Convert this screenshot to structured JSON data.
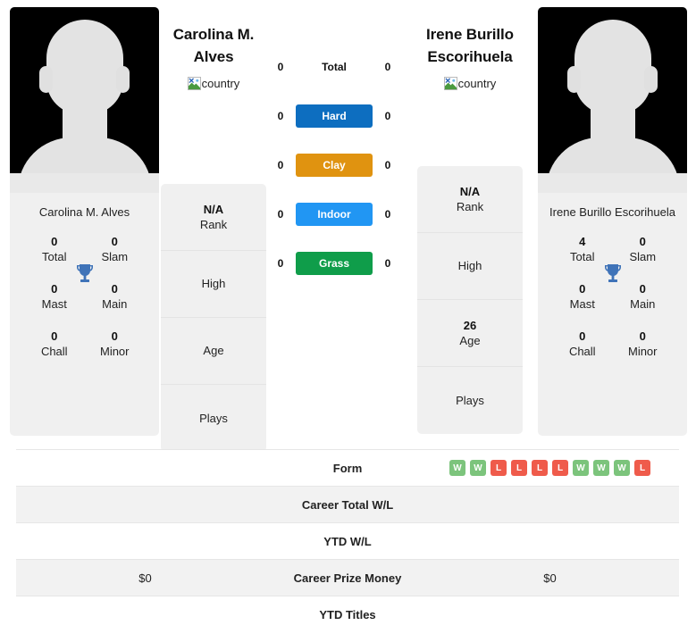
{
  "players": {
    "left": {
      "display_name": "Carolina M. Alves",
      "title_line1": "Carolina M.",
      "title_line2": "Alves",
      "flag_alt": "country",
      "titles": [
        {
          "value": "0",
          "label": "Total"
        },
        {
          "value": "0",
          "label": "Slam"
        },
        {
          "value": "0",
          "label": "Mast"
        },
        {
          "value": "0",
          "label": "Main"
        },
        {
          "value": "0",
          "label": "Chall"
        },
        {
          "value": "0",
          "label": "Minor"
        }
      ],
      "info": [
        {
          "value": "N/A",
          "label": "Rank"
        },
        {
          "value": "",
          "label": "High"
        },
        {
          "value": "",
          "label": "Age"
        },
        {
          "value": "",
          "label": "Plays"
        }
      ]
    },
    "right": {
      "display_name": "Irene Burillo Escorihuela",
      "title_line1": "Irene Burillo",
      "title_line2": "Escorihuela",
      "flag_alt": "country",
      "titles": [
        {
          "value": "4",
          "label": "Total"
        },
        {
          "value": "0",
          "label": "Slam"
        },
        {
          "value": "0",
          "label": "Mast"
        },
        {
          "value": "0",
          "label": "Main"
        },
        {
          "value": "0",
          "label": "Chall"
        },
        {
          "value": "0",
          "label": "Minor"
        }
      ],
      "info": [
        {
          "value": "N/A",
          "label": "Rank"
        },
        {
          "value": "",
          "label": "High"
        },
        {
          "value": "26",
          "label": "Age"
        },
        {
          "value": "",
          "label": "Plays"
        }
      ]
    }
  },
  "surfaces": [
    {
      "label": "Total",
      "left": "0",
      "right": "0",
      "color": "transparent",
      "plain": true
    },
    {
      "label": "Hard",
      "left": "0",
      "right": "0",
      "color": "#0d6ec0",
      "plain": false
    },
    {
      "label": "Clay",
      "left": "0",
      "right": "0",
      "color": "#e09310",
      "plain": false
    },
    {
      "label": "Indoor",
      "left": "0",
      "right": "0",
      "color": "#2196f3",
      "plain": false
    },
    {
      "label": "Grass",
      "left": "0",
      "right": "0",
      "color": "#0f9d4a",
      "plain": false
    }
  ],
  "table": {
    "rows": [
      {
        "label": "Form",
        "left": "",
        "right": "",
        "type": "form"
      },
      {
        "label": "Career Total W/L",
        "left": "",
        "right": "",
        "type": "text"
      },
      {
        "label": "YTD W/L",
        "left": "",
        "right": "",
        "type": "text"
      },
      {
        "label": "Career Prize Money",
        "left": "$0",
        "right": "$0",
        "type": "text"
      },
      {
        "label": "YTD Titles",
        "left": "",
        "right": "",
        "type": "text"
      }
    ],
    "form_right": [
      "W",
      "W",
      "L",
      "L",
      "L",
      "L",
      "W",
      "W",
      "W",
      "L"
    ]
  },
  "colors": {
    "win": "#7cc47c",
    "loss": "#ef5b4b",
    "trophy": "#3f73b8",
    "card_bg": "#f0f0f0",
    "stripe": "#f2f2f2"
  },
  "icons": {
    "trophy": "trophy-icon",
    "broken_image": "broken-image-icon"
  }
}
